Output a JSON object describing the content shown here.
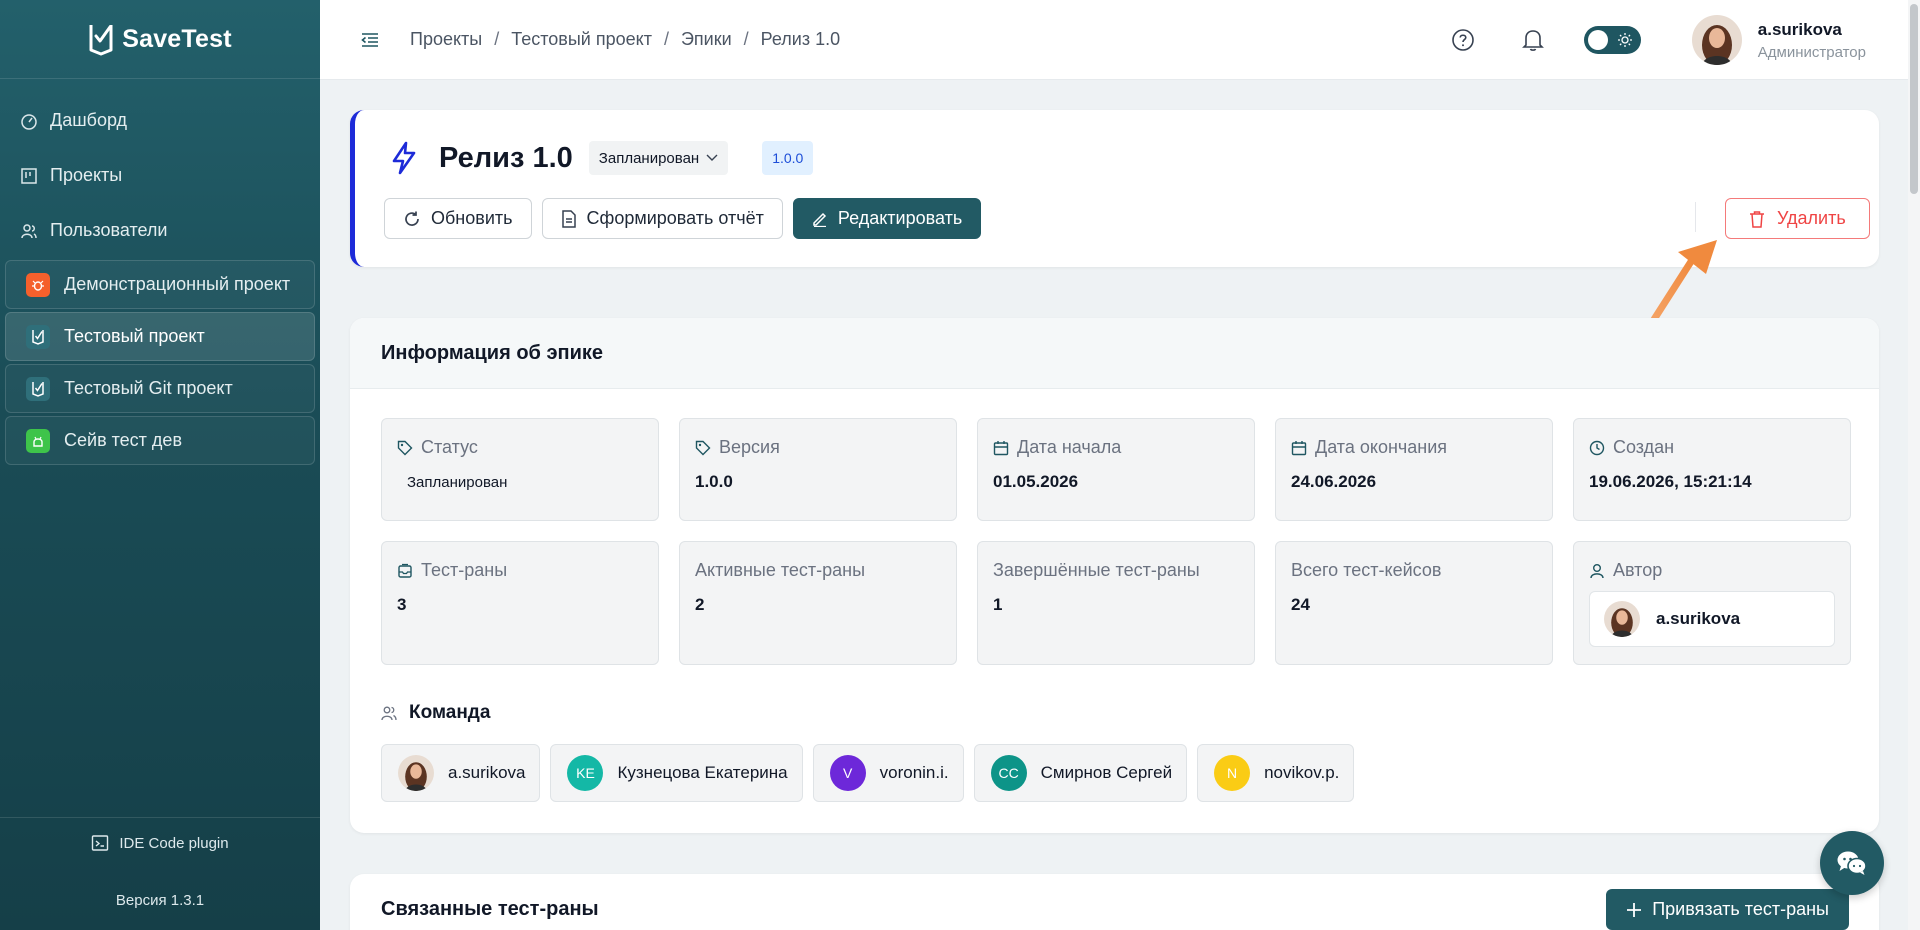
{
  "app": {
    "name": "SaveTest"
  },
  "sidebar": {
    "nav": [
      {
        "label": "Дашборд",
        "icon": "dashboard-icon"
      },
      {
        "label": "Проекты",
        "icon": "projects-icon"
      },
      {
        "label": "Пользователи",
        "icon": "users-icon"
      }
    ],
    "projects": [
      {
        "label": "Демонстрационный проект",
        "badge_color": "#f5602c",
        "active": false
      },
      {
        "label": "Тестовый проект",
        "badge_color": "#2f6f7a",
        "active": true
      },
      {
        "label": "Тестовый Git проект",
        "badge_color": "#2f6f7a",
        "active": false
      },
      {
        "label": "Сейв тест дев",
        "badge_color": "#3ec44a",
        "active": false
      }
    ],
    "plugin_label": "IDE Code plugin",
    "version": "Версия 1.3.1"
  },
  "header": {
    "breadcrumb": [
      "Проекты",
      "Тестовый проект",
      "Эпики",
      "Релиз 1.0"
    ],
    "user": {
      "name": "a.surikova",
      "role": "Администратор"
    }
  },
  "epic": {
    "title": "Релиз 1.0",
    "status": "Запланирован",
    "version_tag": "1.0.0",
    "buttons": {
      "refresh": "Обновить",
      "report": "Сформировать отчёт",
      "edit": "Редактировать",
      "delete": "Удалить"
    },
    "accent_color": "#1d2bd8"
  },
  "info": {
    "title": "Информация об эпике",
    "cells": [
      {
        "label": "Статус",
        "value": "Запланирован"
      },
      {
        "label": "Версия",
        "value": "1.0.0"
      },
      {
        "label": "Дата начала",
        "value": "01.05.2026"
      },
      {
        "label": "Дата окончания",
        "value": "24.06.2026"
      },
      {
        "label": "Создан",
        "value": "19.06.2026, 15:21:14"
      },
      {
        "label": "Тест-раны",
        "value": "3"
      },
      {
        "label": "Активные тест-раны",
        "value": "2"
      },
      {
        "label": "Завершённые тест-раны",
        "value": "1"
      },
      {
        "label": "Всего тест-кейсов",
        "value": "24"
      },
      {
        "label": "Автор",
        "value": "a.surikova"
      }
    ],
    "team_title": "Команда",
    "team": [
      {
        "name": "a.surikova",
        "initials": "",
        "color": "photo"
      },
      {
        "name": "Кузнецова Екатерина",
        "initials": "KE",
        "color": "#14b8a6"
      },
      {
        "name": "voronin.i.",
        "initials": "V",
        "color": "#6d28d9"
      },
      {
        "name": "Смирнов Сергей",
        "initials": "CC",
        "color": "#0d9488"
      },
      {
        "name": "novikov.p.",
        "initials": "N",
        "color": "#facc15"
      }
    ]
  },
  "linked_runs": {
    "title": "Связанные тест-раны",
    "attach_button": "Привязать тест-раны"
  }
}
